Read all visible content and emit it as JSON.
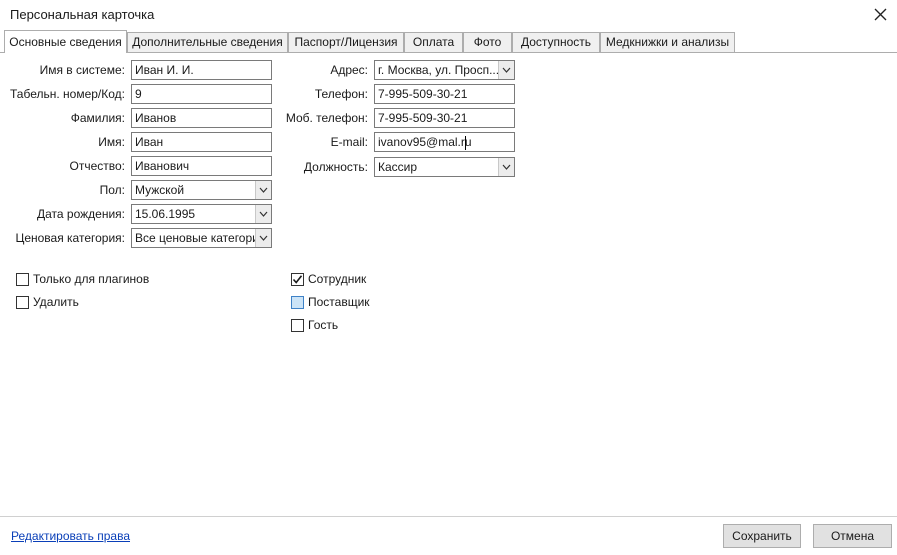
{
  "window": {
    "title": "Персональная карточка"
  },
  "tabs": [
    {
      "label": "Основные сведения"
    },
    {
      "label": "Дополнительные сведения"
    },
    {
      "label": "Паспорт/Лицензия"
    },
    {
      "label": "Оплата"
    },
    {
      "label": "Фото"
    },
    {
      "label": "Доступность"
    },
    {
      "label": "Медкнижки и анализы"
    }
  ],
  "left_fields": [
    {
      "label": "Имя в системе:",
      "value": "Иван И. И."
    },
    {
      "label": "Табельн. номер/Код:",
      "value": "9"
    },
    {
      "label": "Фамилия:",
      "value": "Иванов"
    },
    {
      "label": "Имя:",
      "value": "Иван"
    },
    {
      "label": "Отчество:",
      "value": "Иванович"
    },
    {
      "label": "Пол:",
      "value": "Мужской"
    },
    {
      "label": "Дата рождения:",
      "value": "15.06.1995"
    },
    {
      "label": "Ценовая категория:",
      "value": "Все ценовые категории"
    }
  ],
  "right_fields": [
    {
      "label": "Адрес:",
      "value": "г. Москва, ул. Просп..."
    },
    {
      "label": "Телефон:",
      "value": "7-995-509-30-21"
    },
    {
      "label": "Моб. телефон:",
      "value": "7-995-509-30-21"
    },
    {
      "label": "E-mail:",
      "value": "ivanov95@mal.ru"
    },
    {
      "label": "Должность:",
      "value": "Кассир"
    }
  ],
  "checkboxes_left": [
    {
      "label": "Только для плагинов",
      "checked": false
    },
    {
      "label": "Удалить",
      "checked": false
    }
  ],
  "checkboxes_right": [
    {
      "label": "Сотрудник",
      "checked": true
    },
    {
      "label": "Поставщик",
      "checked": false
    },
    {
      "label": "Гость",
      "checked": false
    }
  ],
  "footer": {
    "edit_rights_link": "Редактировать права",
    "save_label": "Сохранить",
    "cancel_label": "Отмена"
  }
}
